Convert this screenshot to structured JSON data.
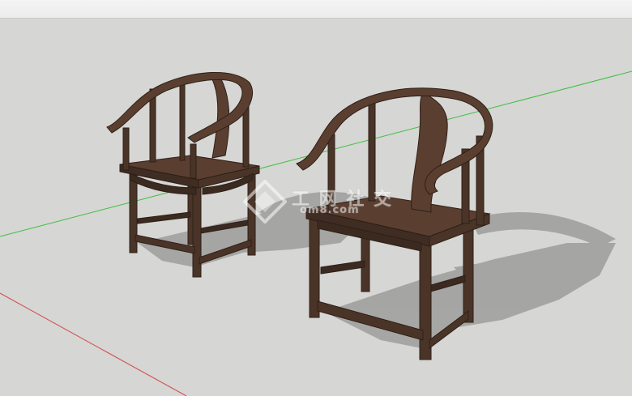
{
  "viewport": {
    "background": "#d6d6d4",
    "axis_colors": {
      "green": "#3fbf3f",
      "red": "#d24b4b"
    }
  },
  "model": {
    "object": "chairs",
    "count": 2,
    "wood_color": "#4a3428",
    "shadow_color": "#9a9a98"
  },
  "watermark": {
    "text": "工 网 社 交",
    "site": "om8.com"
  }
}
